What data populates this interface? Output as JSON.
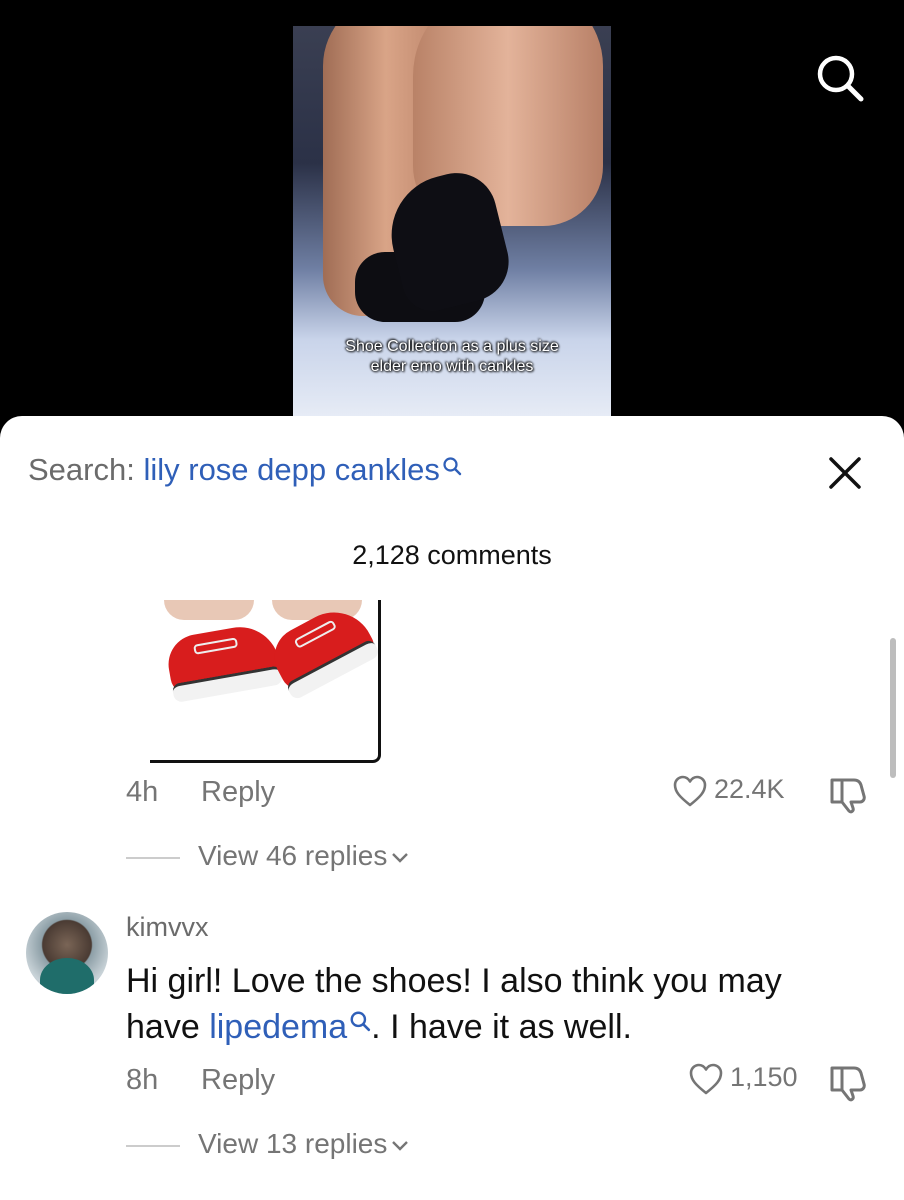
{
  "video": {
    "caption_line1": "Shoe Collection as a plus size",
    "caption_line2": "elder emo with cankles"
  },
  "search": {
    "prefix": "Search:",
    "query": "lily rose depp cankles"
  },
  "comments_header": {
    "count_label": "2,128 comments"
  },
  "comments": [
    {
      "time": "4h",
      "reply_label": "Reply",
      "likes": "22.4K",
      "view_replies": "View 46 replies"
    },
    {
      "username": "kimvvx",
      "text_before": "Hi girl! Love the shoes! I also think you may have ",
      "link": "lipedema",
      "text_after": ". I have it as well.",
      "time": "8h",
      "reply_label": "Reply",
      "likes": "1,150",
      "view_replies": "View 13 replies"
    }
  ],
  "colors": {
    "link_blue": "#2f5fb8",
    "muted_gray": "#757575",
    "sheet_bg": "#ffffff"
  },
  "icons": [
    "search-icon",
    "close-icon",
    "heart-icon",
    "dislike-icon",
    "chevron-down-icon"
  ]
}
